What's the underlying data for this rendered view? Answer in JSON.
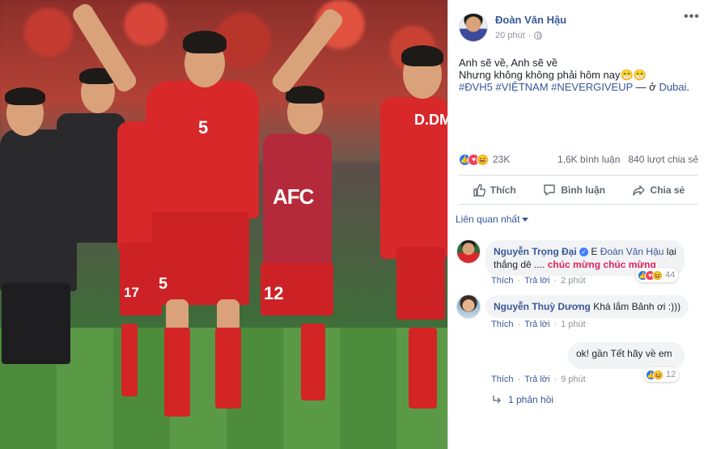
{
  "post": {
    "author": "Đoàn Văn Hậu",
    "time": "20 phút",
    "line1": "Anh sẽ về, Anh sẽ về",
    "line2": "Nhưng không không phải hôm nay😁😁",
    "hashtags": "#ĐVH5 #VIỆTNAM #NEVERGIVEUP",
    "location_prefix": " — ở ",
    "location": "Dubai",
    "location_suffix": "."
  },
  "photo": {
    "jersey_number": "5",
    "shorts_number": "5",
    "left_number": "17",
    "mid_number": "12",
    "right_name": "D.DMI",
    "sponsor": "AFC"
  },
  "stats": {
    "reactions": "23K",
    "comments": "1,6K bình luận",
    "shares": "840 lượt chia sẻ"
  },
  "actions": {
    "like": "Thích",
    "comment": "Bình luận",
    "share": "Chia sẻ"
  },
  "sort_label": "Liên quan nhất",
  "comments": [
    {
      "name": "Nguyễn Trọng Đại",
      "mention_prefix": " E ",
      "mention": "Đoàn Văn Hậu",
      "text_a": " lại thắng dê .... ",
      "text_red": "chúc mừng chúc mừng",
      "like": "Thích",
      "reply": "Trả lời",
      "time": "2 phút",
      "reactions": "44"
    },
    {
      "name": "Nguyễn Thuỳ Dương",
      "text": " Khá lắm Bảnh ơi :)))",
      "like": "Thích",
      "reply": "Trả lời",
      "time": "1 phút"
    },
    {
      "text": "ok! gần Tết hãy về em",
      "like": "Thích",
      "reply": "Trả lời",
      "time": "9 phút",
      "reactions": "12"
    }
  ],
  "more_replies": "1 phản hồi",
  "colors": {
    "link": "#365899",
    "like_blue": "#2078f4",
    "love_red": "#f33e58",
    "haha_yellow": "#f7b125",
    "jersey_red": "#d8282a"
  },
  "icons": [
    "more-icon",
    "globe-icon",
    "like-icon",
    "comment-icon",
    "share-icon",
    "verified-icon",
    "reply-arrow-icon"
  ]
}
